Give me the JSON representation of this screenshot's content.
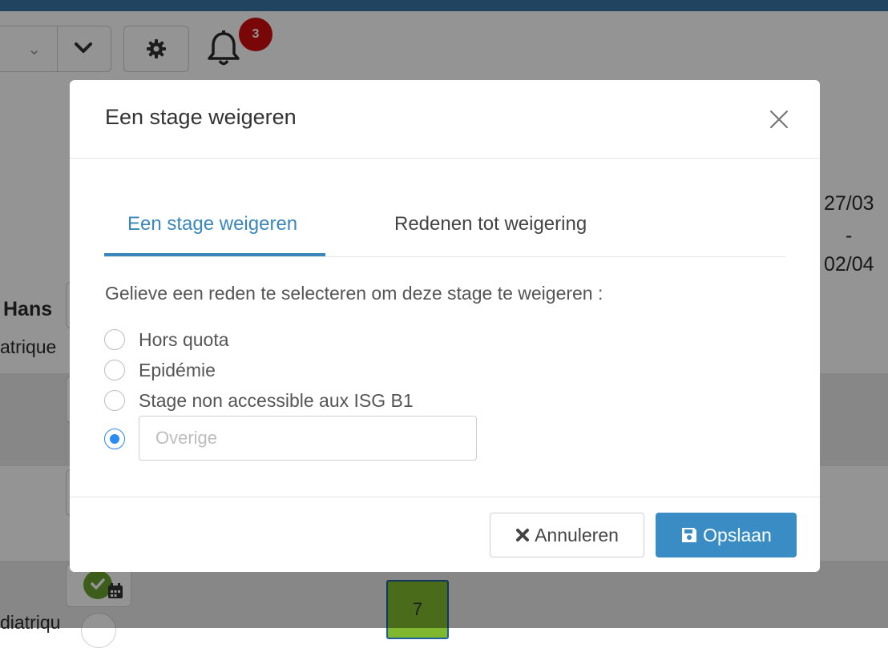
{
  "background": {
    "notification_count": "3",
    "dates": {
      "start": "27/03",
      "separator": "-",
      "end": "02/04"
    },
    "person_name": "Hans",
    "speciality_snippet": "atrique",
    "speciality_snippet_2": "diatriqu",
    "calendar_cell_value": "7"
  },
  "modal": {
    "title": "Een stage weigeren",
    "tabs": [
      {
        "label": "Een stage weigeren",
        "active": true
      },
      {
        "label": "Redenen tot weigering",
        "active": false
      }
    ],
    "prompt": "Gelieve een reden te selecteren om deze stage te weigeren :",
    "options": [
      {
        "label": "Hors quota",
        "selected": false
      },
      {
        "label": "Epidémie",
        "selected": false
      },
      {
        "label": "Stage non accessible aux ISG B1",
        "selected": false
      }
    ],
    "other": {
      "selected": true,
      "placeholder": "Overige",
      "value": ""
    },
    "buttons": {
      "cancel": "Annuleren",
      "save": "Opslaan"
    }
  },
  "colors": {
    "accent": "#3a87bd",
    "primary_button": "#3a8cc4",
    "badge": "#d00d0d",
    "radio_selected": "#2a8cf0"
  }
}
